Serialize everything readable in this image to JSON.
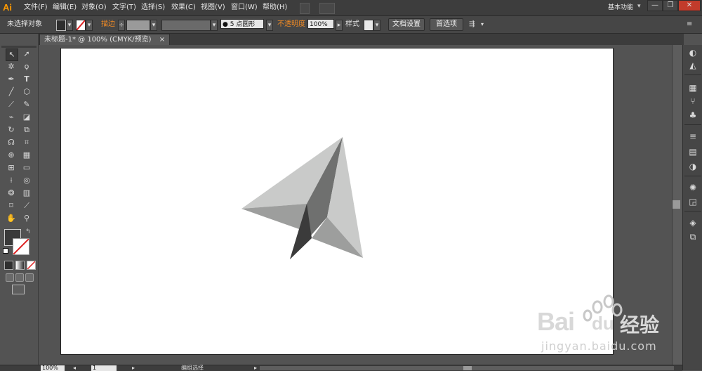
{
  "app": {
    "logo": "Ai"
  },
  "menu": [
    "文件(F)",
    "编辑(E)",
    "对象(O)",
    "文字(T)",
    "选择(S)",
    "效果(C)",
    "视图(V)",
    "窗口(W)",
    "帮助(H)"
  ],
  "workspace": "基本功能",
  "window_controls": {
    "minimize": "—",
    "restore": "❐",
    "close": "✕"
  },
  "control_bar": {
    "selection_status": "未选择对象",
    "stroke_label": "描边",
    "brush_value": "5 点圆形",
    "opacity_label": "不透明度",
    "opacity_value": "100%",
    "style_label": "样式",
    "doc_setup_button": "文档设置",
    "preferences_button": "首选项"
  },
  "document_tab": {
    "title": "未标题-1* @ 100% (CMYK/预览)",
    "close": "×"
  },
  "statusbar": {
    "zoom": "100%",
    "page": "1",
    "tool_status": "编组选择"
  },
  "watermark": {
    "brand": "Bai",
    "brand2": "du",
    "suffix": "经验",
    "url": "jingyan.baidu.com"
  },
  "colors": {
    "accent": "#f08a24",
    "fill": "#3a3a3a",
    "plane_light": "#c9cac9",
    "plane_mid": "#9d9e9d",
    "plane_dark": "#6f706f",
    "plane_shadow": "#3b3b3b"
  },
  "icons": [
    "selection-tool-icon",
    "direct-selection-tool-icon",
    "magic-wand-icon",
    "lasso-icon",
    "pen-tool-icon",
    "type-tool-icon",
    "line-tool-icon",
    "rectangle-tool-icon",
    "paintbrush-icon",
    "pencil-icon",
    "blob-brush-icon",
    "eraser-icon",
    "rotate-icon",
    "scale-icon",
    "warp-icon",
    "free-transform-icon",
    "shape-builder-icon",
    "perspective-grid-icon",
    "mesh-icon",
    "gradient-icon",
    "eyedropper-icon",
    "blend-icon",
    "symbol-sprayer-icon",
    "graph-icon",
    "artboard-icon",
    "slice-icon",
    "hand-icon",
    "zoom-icon"
  ]
}
